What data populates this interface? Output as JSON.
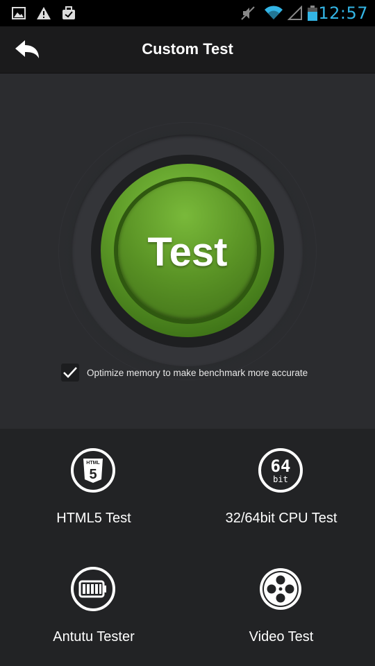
{
  "status_bar": {
    "time": "12:57",
    "icons": [
      "image-icon",
      "warning-icon",
      "briefcase-icon",
      "mute-icon",
      "wifi-icon",
      "signal-icon",
      "battery-icon"
    ],
    "time_color": "#33b5e5"
  },
  "header": {
    "title": "Custom Test",
    "back_icon": "back-arrow-icon"
  },
  "test_button": {
    "label": "Test",
    "color": "#5d9a27"
  },
  "option": {
    "checked": true,
    "label": "Optimize memory to make benchmark more accurate"
  },
  "tiles": [
    {
      "label": "HTML5 Test",
      "icon": "html5-icon",
      "icon_text": "HTML",
      "icon_digit": "5"
    },
    {
      "label": "32/64bit CPU Test",
      "icon": "64bit-icon",
      "icon_text": "64",
      "icon_sub": "bit"
    },
    {
      "label": "Antutu Tester",
      "icon": "battery-tester-icon"
    },
    {
      "label": "Video Test",
      "icon": "video-reel-icon"
    }
  ]
}
